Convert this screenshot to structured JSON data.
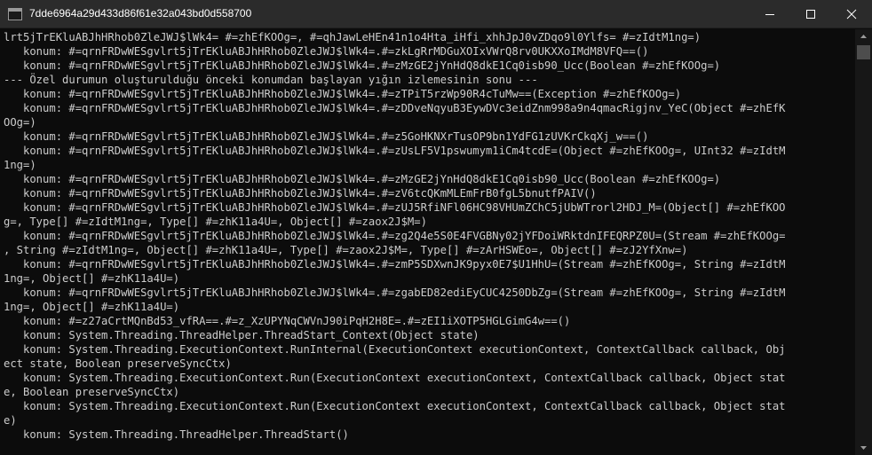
{
  "window": {
    "title": "7dde6964a29d433d86f61e32a043bd0d558700"
  },
  "icons": {
    "app": "console-app-icon",
    "minimize": "minimize-icon",
    "maximize": "maximize-icon",
    "close": "close-icon",
    "scroll_up": "arrow-up-icon",
    "scroll_down": "arrow-down-icon"
  },
  "colors": {
    "background": "#0c0c0c",
    "text": "#cccccc",
    "titlebar": "#2b2b2b"
  },
  "console": {
    "lines": [
      "lrt5jTrEKluABJhHRhob0ZleJWJ$lWk4= #=zhEfKOOg=, #=qhJawLeHEn41n1o4Hta_iHfi_xhhJpJ0vZDqo9l0Ylfs= #=zIdtM1ng=)",
      "   konum: #=qrnFRDwWESgvlrt5jTrEKluABJhHRhob0ZleJWJ$lWk4=.#=zkLgRrMDGuXOIxVWrQ8rv0UKXXoIMdM8VFQ==()",
      "   konum: #=qrnFRDwWESgvlrt5jTrEKluABJhHRhob0ZleJWJ$lWk4=.#=zMzGE2jYnHdQ8dkE1Cq0isb90_Ucc(Boolean #=zhEfKOOg=)",
      "--- Özel durumun oluşturulduğu önceki konumdan başlayan yığın izlemesinin sonu ---",
      "   konum: #=qrnFRDwWESgvlrt5jTrEKluABJhHRhob0ZleJWJ$lWk4=.#=zTPiT5rzWp90R4cTuMw==(Exception #=zhEfKOOg=)",
      "   konum: #=qrnFRDwWESgvlrt5jTrEKluABJhHRhob0ZleJWJ$lWk4=.#=zDDveNqyuB3EywDVc3eidZnm998a9n4qmacRigjnv_YeC(Object #=zhEfKOOg=)",
      "",
      "   konum: #=qrnFRDwWESgvlrt5jTrEKluABJhHRhob0ZleJWJ$lWk4=.#=z5GoHKNXrTusOP9bn1YdFG1zUVKrCkqXj_w==()",
      "   konum: #=qrnFRDwWESgvlrt5jTrEKluABJhHRhob0ZleJWJ$lWk4=.#=zUsLF5V1pswumym1iCm4tcdE=(Object #=zhEfKOOg=, UInt32 #=zIdtM1ng=)",
      "",
      "   konum: #=qrnFRDwWESgvlrt5jTrEKluABJhHRhob0ZleJWJ$lWk4=.#=zMzGE2jYnHdQ8dkE1Cq0isb90_Ucc(Boolean #=zhEfKOOg=)",
      "   konum: #=qrnFRDwWESgvlrt5jTrEKluABJhHRhob0ZleJWJ$lWk4=.#=zV6tcQKmMLEmFrB0fgL5bnutfPAIV()",
      "   konum: #=qrnFRDwWESgvlrt5jTrEKluABJhHRhob0ZleJWJ$lWk4=.#=zUJ5RfiNFl06HC98VHUmZChC5jUbWTrorl2HDJ_M=(Object[] #=zhEfKOOg=, Type[] #=zIdtM1ng=, Type[] #=zhK11a4U=, Object[] #=zaox2J$M=)",
      "",
      "   konum: #=qrnFRDwWESgvlrt5jTrEKluABJhHRhob0ZleJWJ$lWk4=.#=zg2Q4e5S0E4FVGBNy02jYFDoiWRktdnIFEQRPZ0U=(Stream #=zhEfKOOg=, String #=zIdtM1ng=, Object[] #=zhK11a4U=, Type[] #=zaox2J$M=, Type[] #=zArHSWEo=, Object[] #=zJ2YfXnw=)",
      "",
      "   konum: #=qrnFRDwWESgvlrt5jTrEKluABJhHRhob0ZleJWJ$lWk4=.#=zmP5SDXwnJK9pyx0E7$U1HhU=(Stream #=zhEfKOOg=, String #=zIdtM1ng=, Object[] #=zhK11a4U=)",
      "",
      "   konum: #=qrnFRDwWESgvlrt5jTrEKluABJhHRhob0ZleJWJ$lWk4=.#=zgabED82ediEyCUC4250DbZg=(Stream #=zhEfKOOg=, String #=zIdtM1ng=, Object[] #=zhK11a4U=)",
      "",
      "   konum: #=z27aCrtMQnBd53_vfRA==.#=z_XzUPYNqCWVnJ90iPqH2H8E=.#=zEI1iXOTP5HGLGimG4w==()",
      "   konum: System.Threading.ThreadHelper.ThreadStart_Context(Object state)",
      "   konum: System.Threading.ExecutionContext.RunInternal(ExecutionContext executionContext, ContextCallback callback, Object state, Boolean preserveSyncCtx)",
      "",
      "   konum: System.Threading.ExecutionContext.Run(ExecutionContext executionContext, ContextCallback callback, Object state, Boolean preserveSyncCtx)",
      "",
      "   konum: System.Threading.ExecutionContext.Run(ExecutionContext executionContext, ContextCallback callback, Object state)",
      "",
      "   konum: System.Threading.ThreadHelper.ThreadStart()"
    ],
    "display": [
      "lrt5jTrEKluABJhHRhob0ZleJWJ$lWk4= #=zhEfKOOg=, #=qhJawLeHEn41n1o4Hta_iHfi_xhhJpJ0vZDqo9l0Ylfs= #=zIdtM1ng=)",
      "   konum: #=qrnFRDwWESgvlrt5jTrEKluABJhHRhob0ZleJWJ$lWk4=.#=zkLgRrMDGuXOIxVWrQ8rv0UKXXoIMdM8VFQ==()",
      "   konum: #=qrnFRDwWESgvlrt5jTrEKluABJhHRhob0ZleJWJ$lWk4=.#=zMzGE2jYnHdQ8dkE1Cq0isb90_Ucc(Boolean #=zhEfKOOg=)",
      "--- Özel durumun oluşturulduğu önceki konumdan başlayan yığın izlemesinin sonu ---",
      "   konum: #=qrnFRDwWESgvlrt5jTrEKluABJhHRhob0ZleJWJ$lWk4=.#=zTPiT5rzWp90R4cTuMw==(Exception #=zhEfKOOg=)",
      "   konum: #=qrnFRDwWESgvlrt5jTrEKluABJhHRhob0ZleJWJ$lWk4=.#=zDDveNqyuB3EywDVc3eidZnm998a9n4qmacRigjnv_YeC(Object #=zhEfK",
      "OOg=)",
      "   konum: #=qrnFRDwWESgvlrt5jTrEKluABJhHRhob0ZleJWJ$lWk4=.#=z5GoHKNXrTusOP9bn1YdFG1zUVKrCkqXj_w==()",
      "   konum: #=qrnFRDwWESgvlrt5jTrEKluABJhHRhob0ZleJWJ$lWk4=.#=zUsLF5V1pswumym1iCm4tcdE=(Object #=zhEfKOOg=, UInt32 #=zIdtM",
      "1ng=)",
      "   konum: #=qrnFRDwWESgvlrt5jTrEKluABJhHRhob0ZleJWJ$lWk4=.#=zMzGE2jYnHdQ8dkE1Cq0isb90_Ucc(Boolean #=zhEfKOOg=)",
      "   konum: #=qrnFRDwWESgvlrt5jTrEKluABJhHRhob0ZleJWJ$lWk4=.#=zV6tcQKmMLEmFrB0fgL5bnutfPAIV()",
      "   konum: #=qrnFRDwWESgvlrt5jTrEKluABJhHRhob0ZleJWJ$lWk4=.#=zUJ5RfiNFl06HC98VHUmZChC5jUbWTrorl2HDJ_M=(Object[] #=zhEfKOO",
      "g=, Type[] #=zIdtM1ng=, Type[] #=zhK11a4U=, Object[] #=zaox2J$M=)",
      "   konum: #=qrnFRDwWESgvlrt5jTrEKluABJhHRhob0ZleJWJ$lWk4=.#=zg2Q4e5S0E4FVGBNy02jYFDoiWRktdnIFEQRPZ0U=(Stream #=zhEfKOOg=",
      ", String #=zIdtM1ng=, Object[] #=zhK11a4U=, Type[] #=zaox2J$M=, Type[] #=zArHSWEo=, Object[] #=zJ2YfXnw=)",
      "   konum: #=qrnFRDwWESgvlrt5jTrEKluABJhHRhob0ZleJWJ$lWk4=.#=zmP5SDXwnJK9pyx0E7$U1HhU=(Stream #=zhEfKOOg=, String #=zIdtM",
      "1ng=, Object[] #=zhK11a4U=)",
      "   konum: #=qrnFRDwWESgvlrt5jTrEKluABJhHRhob0ZleJWJ$lWk4=.#=zgabED82ediEyCUC4250DbZg=(Stream #=zhEfKOOg=, String #=zIdtM",
      "1ng=, Object[] #=zhK11a4U=)",
      "   konum: #=z27aCrtMQnBd53_vfRA==.#=z_XzUPYNqCWVnJ90iPqH2H8E=.#=zEI1iXOTP5HGLGimG4w==()",
      "   konum: System.Threading.ThreadHelper.ThreadStart_Context(Object state)",
      "   konum: System.Threading.ExecutionContext.RunInternal(ExecutionContext executionContext, ContextCallback callback, Obj",
      "ect state, Boolean preserveSyncCtx)",
      "   konum: System.Threading.ExecutionContext.Run(ExecutionContext executionContext, ContextCallback callback, Object stat",
      "e, Boolean preserveSyncCtx)",
      "   konum: System.Threading.ExecutionContext.Run(ExecutionContext executionContext, ContextCallback callback, Object stat",
      "e)",
      "   konum: System.Threading.ThreadHelper.ThreadStart()",
      ""
    ]
  }
}
